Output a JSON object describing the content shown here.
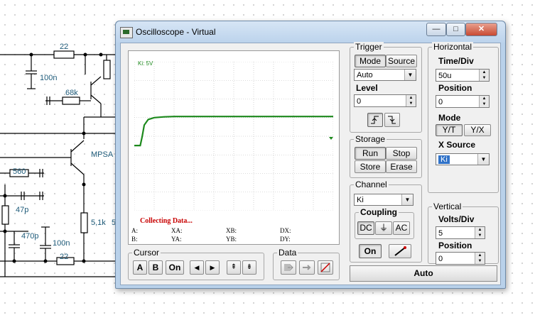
{
  "window": {
    "title": "Oscilloscope - Virtual",
    "minimize": "—",
    "maximize": "□",
    "close": "✕"
  },
  "screen": {
    "channel_label": "Ki: 5V",
    "status": "Collecting Data...",
    "readouts": {
      "A": "A:",
      "B": "B:",
      "XA": "XA:",
      "YA": "YA:",
      "XB": "XB:",
      "YB": "YB:",
      "DX": "DX:",
      "DY": "DY:"
    }
  },
  "trigger": {
    "title": "Trigger",
    "mode_label": "Mode",
    "source_label": "Source",
    "mode_value": "Auto",
    "level_label": "Level",
    "level_value": "0",
    "rising_icon": "rising-edge",
    "falling_icon": "falling-edge"
  },
  "storage": {
    "title": "Storage",
    "run": "Run",
    "stop": "Stop",
    "store": "Store",
    "erase": "Erase"
  },
  "channel": {
    "title": "Channel",
    "value": "Ki",
    "coupling_title": "Coupling",
    "dc": "DC",
    "gnd": "⏚",
    "ac": "AC",
    "on": "On",
    "probe_icon": "probe"
  },
  "horizontal": {
    "title": "Horizontal",
    "time_div_label": "Time/Div",
    "time_div_value": "50u",
    "position_label": "Position",
    "position_value": "0",
    "mode_label": "Mode",
    "yt": "Y/T",
    "yx": "Y/X",
    "xsource_label": "X Source",
    "xsource_value": "Ki"
  },
  "vertical": {
    "title": "Vertical",
    "volts_div_label": "Volts/Div",
    "volts_div_value": "5",
    "position_label": "Position",
    "position_value": "0"
  },
  "cursor": {
    "title": "Cursor",
    "a": "A",
    "b": "B",
    "on": "On",
    "left": "◀",
    "right": "▶",
    "up": "⇞",
    "down": "⇟"
  },
  "data": {
    "title": "Data"
  },
  "auto_label": "Auto",
  "schematic": {
    "labels": [
      "22",
      "100n",
      "68k",
      "MPSA",
      "560",
      "47p",
      "470p",
      "100n",
      "5,1k",
      "22",
      "5"
    ]
  },
  "chart_data": {
    "type": "line",
    "series": [
      {
        "values_note": "",
        "x": [
          0,
          0.3,
          0.4,
          0.5,
          0.7,
          1.0,
          1.5,
          2,
          3,
          10
        ],
        "y": [
          -2.5,
          -2.5,
          0.0,
          3.0,
          4.5,
          5.0,
          5.2,
          5.3,
          5.3,
          5.3
        ]
      }
    ],
    "xlim": [
      0,
      10
    ],
    "ylim": [
      -4,
      4
    ]
  }
}
